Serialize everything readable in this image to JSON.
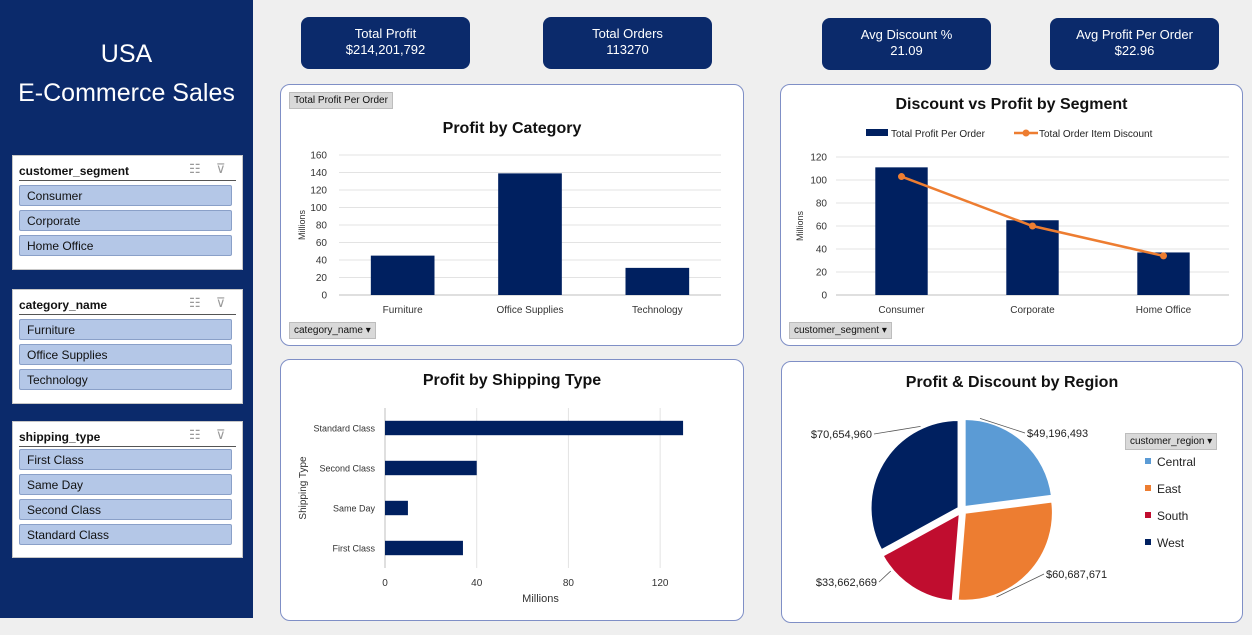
{
  "sidebar": {
    "title_line1": "USA",
    "title_line2": "E-Commerce Sales",
    "slicers": [
      {
        "field": "customer_segment",
        "items": [
          "Consumer",
          "Corporate",
          "Home Office"
        ]
      },
      {
        "field": "category_name",
        "items": [
          "Furniture",
          "Office Supplies",
          "Technology"
        ]
      },
      {
        "field": "shipping_type",
        "items": [
          "First Class",
          "Same Day",
          "Second Class",
          "Standard Class"
        ]
      }
    ]
  },
  "kpis": [
    {
      "label": "Total Profit",
      "value": "$214,201,792"
    },
    {
      "label": "Total Orders",
      "value": "113270"
    },
    {
      "label": "Avg Discount %",
      "value": "21.09"
    },
    {
      "label": "Avg Profit Per Order",
      "value": "$22.96"
    }
  ],
  "colors": {
    "navy": "#002060",
    "orange": "#ed7d31",
    "central": "#5b9bd5",
    "east": "#ed7d31",
    "south": "#c00d2f",
    "west": "#002060"
  },
  "chart_data": [
    {
      "type": "bar",
      "title": "Profit by Category",
      "field_button": "Total Profit Per Order",
      "filter_button": "category_name",
      "ylabel": "Millions",
      "categories": [
        "Furniture",
        "Office Supplies",
        "Technology"
      ],
      "values": [
        45,
        139,
        31
      ],
      "ylim": [
        0,
        160
      ],
      "yticks": [
        0,
        20,
        40,
        60,
        80,
        100,
        120,
        140,
        160
      ],
      "grid": true
    },
    {
      "type": "bar",
      "title": "Discount vs Profit by Segment",
      "filter_button": "customer_segment",
      "ylabel": "Millions",
      "categories": [
        "Consumer",
        "Corporate",
        "Home Office"
      ],
      "series": [
        {
          "name": "Total Profit Per Order",
          "kind": "bar",
          "values": [
            111,
            65,
            37
          ]
        },
        {
          "name": "Total Order Item Discount",
          "kind": "line",
          "values": [
            103,
            60,
            34
          ]
        }
      ],
      "ylim": [
        0,
        120
      ],
      "yticks": [
        0,
        20,
        40,
        60,
        80,
        100,
        120
      ],
      "legend": "top",
      "grid": true
    },
    {
      "type": "bar",
      "orientation": "horizontal",
      "title": "Profit by Shipping Type",
      "xlabel": "Millions",
      "ylabel": "Shipping Type",
      "categories": [
        "Standard Class",
        "Second Class",
        "Same Day",
        "First Class"
      ],
      "values": [
        130,
        40,
        10,
        34
      ],
      "xlim": [
        0,
        140
      ],
      "xticks": [
        0,
        40,
        80,
        120
      ],
      "grid": true
    },
    {
      "type": "pie",
      "title": "Profit & Discount by Region",
      "filter_button": "customer_region",
      "labels": [
        "Central",
        "East",
        "South",
        "West"
      ],
      "values": [
        49196493,
        60687671,
        33662669,
        70654960
      ],
      "value_labels": [
        "$49,196,493",
        "$60,687,671",
        "$33,662,669",
        "$70,654,960"
      ],
      "legend": "right"
    }
  ]
}
